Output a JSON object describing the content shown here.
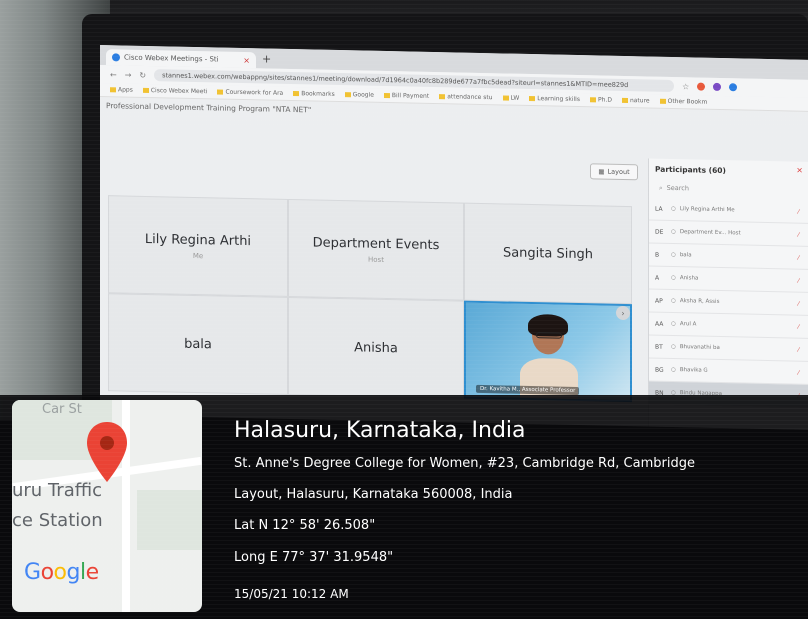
{
  "browser": {
    "tab_title": "Cisco Webex Meetings - Sti",
    "tab_close": "×",
    "new_tab": "+",
    "url": "stannes1.webex.com/webappng/sites/stannes1/meeting/download/7d1964c0a40fc8b289de677a7fbc5dead?siteurl=stannes1&MTID=mee829d",
    "bookmarks": [
      "Apps",
      "Cisco Webex Meeti",
      "Coursework for Ara",
      "Bookmarks",
      "Google",
      "Bill Payment",
      "attendance stu",
      "LW",
      "Learning skills",
      "Ph.D",
      "nature",
      "Other Bookm"
    ]
  },
  "meeting": {
    "title": "Professional Development Training Program \"NTA NET\"",
    "layout_label": "Layout",
    "tiles": [
      {
        "name": "Lily Regina Arthi",
        "role": "Me"
      },
      {
        "name": "Department Events",
        "role": "Host"
      },
      {
        "name": "Sangita Singh",
        "role": ""
      },
      {
        "name": "bala",
        "role": ""
      },
      {
        "name": "Anisha",
        "role": ""
      }
    ],
    "video_tile_label": "Dr. Kavitha M., Associate Professor"
  },
  "participants": {
    "header": "Participants (60)",
    "search_placeholder": "Search",
    "rows": [
      {
        "initials": "LA",
        "name": "Lily Regina Arthi Me"
      },
      {
        "initials": "DE",
        "name": "Department Ev... Host"
      },
      {
        "initials": "B",
        "name": "bala"
      },
      {
        "initials": "A",
        "name": "Anisha"
      },
      {
        "initials": "AP",
        "name": "Aksha R, Assis"
      },
      {
        "initials": "AA",
        "name": "Arul A"
      },
      {
        "initials": "BT",
        "name": "Bhuvanathi ba"
      },
      {
        "initials": "BG",
        "name": "Bhavika G"
      },
      {
        "initials": "BN",
        "name": "Bindu Nagappa"
      }
    ]
  },
  "geotag": {
    "map_top_label": "Car St",
    "map_line1": "uru Traffic",
    "map_line2": "ce Station",
    "google": [
      "G",
      "o",
      "o",
      "g",
      "l",
      "e"
    ],
    "google_colors": [
      "#4285F4",
      "#EA4335",
      "#FBBC05",
      "#4285F4",
      "#34A853",
      "#EA4335"
    ],
    "pin_color": "#EA4335",
    "title": "Halasuru, Karnataka, India",
    "address_line1": "St. Anne's Degree College for Women, #23, Cambridge Rd, Cambridge",
    "address_line2": "Layout, Halasuru, Karnataka 560008, India",
    "lat": "Lat N 12° 58' 26.508\"",
    "long": "Long E 77° 37' 31.9548\"",
    "datetime": "15/05/21 10:12 AM"
  }
}
